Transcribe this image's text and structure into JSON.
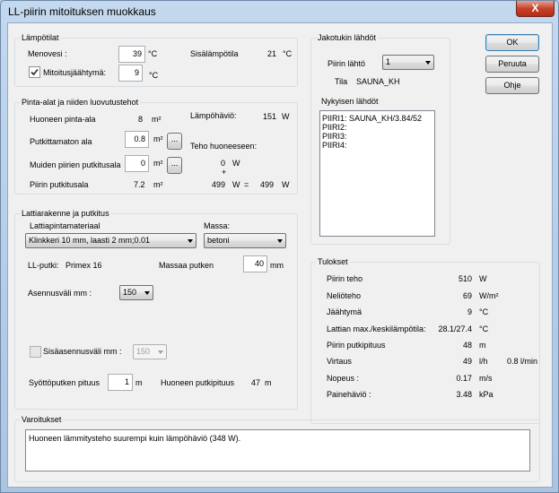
{
  "window": {
    "title": "LL-piirin mitoituksen muokkaus",
    "close_glyph": "X"
  },
  "temps": {
    "group_label": "Lämpötilat",
    "menovesi_label": "Menovesi :",
    "menovesi_value": "39",
    "menovesi_unit": "°C",
    "sisalampotila_label": "Sisälämpötila",
    "sisalampotila_value": "21",
    "sisalampotila_unit": "°C",
    "mitoitus_label": "Mitoitusjäähtymä:",
    "mitoitus_value": "9",
    "mitoitus_unit": "°C",
    "mitoitus_checked": true
  },
  "areas": {
    "group_label": "Pinta-alat ja niiden luovutustehot",
    "huone_label": "Huoneen pinta-ala",
    "huone_value": "8",
    "huone_unit": "m²",
    "lampohavio_label": "Lämpöhäviö:",
    "lampohavio_value": "151",
    "lampohavio_unit": "W",
    "putkittamaton_label": "Putkittamaton ala",
    "putkittamaton_value": "0.8",
    "putkittamaton_unit": "m²",
    "teho_label": "Teho huoneeseen:",
    "muiden_label": "Muiden piirien putkitusala",
    "muiden_value": "0",
    "muiden_unit": "m²",
    "muiden_w_value": "0",
    "muiden_w_unit": "W",
    "plus": "+",
    "piirin_label": "Piirin putkitusala",
    "piirin_value": "7.2",
    "piirin_unit": "m²",
    "piirin_w_value": "499",
    "piirin_w_unit": "W",
    "equals": "=",
    "total_value": "499",
    "total_unit": "W",
    "ellipsis": "..."
  },
  "floor": {
    "group_label": "Lattiarakenne ja putkitus",
    "material_label": "Lattiapintamateriaal",
    "material_value": "Klinkkeri 10 mm, laasti 2 mm;0.01",
    "massa_label": "Massa:",
    "massa_value": "betoni",
    "llputki_label": "LL-putki:",
    "llputki_value": "Primex 16",
    "massaa_label": "Massaa putken",
    "massaa_value": "40",
    "massaa_unit": "mm",
    "asennus_label": "Asennusväli mm :",
    "asennus_value": "150",
    "sisa_label": "Sisäasennusväli mm :",
    "sisa_value": "150",
    "sisa_checked": false,
    "syotto_label": "Syöttöputken pituus",
    "syotto_value": "1",
    "syotto_unit": "m",
    "huone_putki_label": "Huoneen putkipituus",
    "huone_putki_value": "47",
    "huone_putki_unit": "m"
  },
  "jakotukki": {
    "group_label": "Jakotukin lähdöt",
    "piirin_lahto_label": "Piirin lähtö",
    "piirin_lahto_value": "1",
    "tila_label": "Tila",
    "tila_value": "SAUNA_KH",
    "nykyisen_label": "Nykyisen lähdöt",
    "items": [
      "PIIRI1: SAUNA_KH/3.84/52",
      "PIIRI2:",
      "PIIRI3:",
      "PIIRI4:"
    ]
  },
  "buttons": {
    "ok": "OK",
    "peruuta": "Peruuta",
    "ohje": "Ohje"
  },
  "results": {
    "group_label": "Tulokset",
    "rows": [
      {
        "label": "Piirin teho",
        "value": "510",
        "unit": "W"
      },
      {
        "label": "Neliöteho",
        "value": "69",
        "unit": "W/m²"
      },
      {
        "label": "Jäähtymä",
        "value": "9",
        "unit": "°C"
      },
      {
        "label": "Lattian max./keskilämpötila:",
        "value": "28.1/27.4",
        "unit": "°C"
      },
      {
        "label": "Piirin putkipituus",
        "value": "48",
        "unit": "m"
      },
      {
        "label": "Virtaus",
        "value": "49",
        "unit": "l/h"
      },
      {
        "label": "Nopeus :",
        "value": "0.17",
        "unit": "m/s"
      },
      {
        "label": "Painehäviö :",
        "value": "3.48",
        "unit": "kPa"
      }
    ],
    "virtaus_extra": "0.8 l/min"
  },
  "warnings": {
    "group_label": "Varoitukset",
    "text": "Huoneen lämmitysteho suurempi kuin lämpöhäviö (348 W)."
  }
}
